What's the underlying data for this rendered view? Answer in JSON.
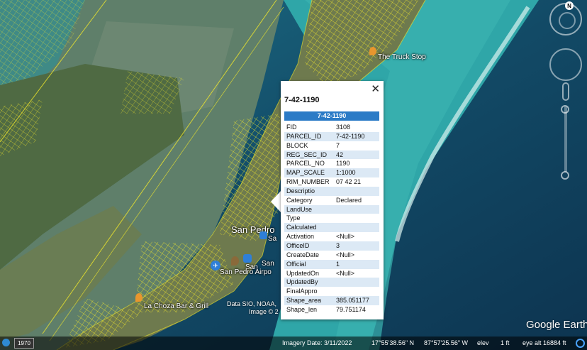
{
  "map": {
    "places": {
      "truck_stop": "The Truck Stop",
      "san_pedro": "San Pedro",
      "san_pedro_partial": "Sa",
      "san_short_a": "San",
      "san_short_b": "San",
      "airport": "San Pedro Airpo",
      "la_choza": "La Choza Bar & Grill"
    },
    "attribution": {
      "line1": "Data SIO, NOAA,",
      "line2": "Image © 2"
    },
    "colors": {
      "parcel_lines": "#f2e92a",
      "pin_orange": "#e8962e",
      "pin_brown": "#8a6a3a",
      "pin_blue": "#2f7fd8"
    },
    "navigation": {
      "north_label": "N"
    }
  },
  "balloon": {
    "title": "7-42-1190",
    "header": "7-42-1190",
    "close_icon": "✕",
    "rows": [
      {
        "key": "FID",
        "value": "3108"
      },
      {
        "key": "PARCEL_ID",
        "value": "7-42-1190"
      },
      {
        "key": "BLOCK",
        "value": "7"
      },
      {
        "key": "REG_SEC_ID",
        "value": "42"
      },
      {
        "key": "PARCEL_NO",
        "value": "1190"
      },
      {
        "key": "MAP_SCALE",
        "value": "1:1000"
      },
      {
        "key": "RIM_NUMBER",
        "value": "07 42 21"
      },
      {
        "key": "Descriptio",
        "value": ""
      },
      {
        "key": "Category",
        "value": "Declared"
      },
      {
        "key": "LandUse",
        "value": ""
      },
      {
        "key": "Type",
        "value": ""
      },
      {
        "key": "Calculated",
        "value": ""
      },
      {
        "key": "Activation",
        "value": "<Null>"
      },
      {
        "key": "OfficeID",
        "value": "3"
      },
      {
        "key": "CreateDate",
        "value": "<Null>"
      },
      {
        "key": "Official",
        "value": "1"
      },
      {
        "key": "UpdatedOn",
        "value": "<Null>"
      },
      {
        "key": "UpdatedBy",
        "value": ""
      },
      {
        "key": "FinalAppro",
        "value": ""
      },
      {
        "key": "Shape_area",
        "value": "385.051177"
      },
      {
        "key": "Shape_len",
        "value": "79.751174"
      }
    ]
  },
  "status": {
    "year": "1970",
    "imagery_date": "Imagery Date: 3/11/2022",
    "latitude": "17°55'38.56\" N",
    "longitude": "87°57'25.56\" W",
    "elev_label": "elev",
    "elev_value": "1 ft",
    "eye_alt": "eye alt  16884 ft"
  },
  "logo": "Google Earth"
}
